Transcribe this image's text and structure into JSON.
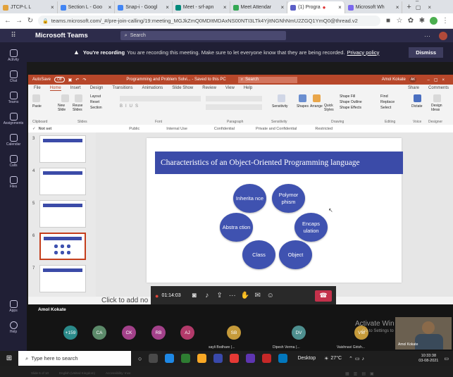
{
  "browser": {
    "tabs": [
      {
        "label": "JTCP-L L",
        "color": "#e2a23b"
      },
      {
        "label": "Section L - Goo",
        "color": "#4285f4"
      },
      {
        "label": "Snap-i - Googl",
        "color": "#4285f4"
      },
      {
        "label": "Meet - srf-apn",
        "color": "#00897b"
      },
      {
        "label": "Meet Attendar",
        "color": "#34a853"
      },
      {
        "label": "(1) Progra",
        "color": "#5b5fc7"
      },
      {
        "label": "Microsoft Wh",
        "color": "#7b68ee"
      }
    ],
    "url": "teams.microsoft.com/_#/pre-join-calling/19:meeting_MGJkZmQ0MDItMDAxNS00NTI3LTk4YjItNGNhNmU2ZGQ1YmQ0@thread.v2"
  },
  "teams": {
    "app_name": "Microsoft Teams",
    "search_placeholder": "Search",
    "rail": [
      "Activity",
      "Chat",
      "Teams",
      "Assignments",
      "Calendar",
      "Calls",
      "Files",
      "Apps",
      "Help"
    ],
    "recording_bold": "You're recording",
    "recording_msg": "You are recording this meeting. Make sure to let everyone know that they are being recorded.",
    "privacy_link": "Privacy policy",
    "dismiss": "Dismiss"
  },
  "ppt": {
    "autosave": "AutoSave",
    "autosave_state": "Off",
    "doc_title": "Programming and Problem Solvi... - Saved to this PC",
    "search": "Search",
    "user": "Amol Kokate",
    "user_initials": "AK",
    "tabs": [
      "File",
      "Home",
      "Insert",
      "Design",
      "Transitions",
      "Animations",
      "Slide Show",
      "Review",
      "View",
      "Help"
    ],
    "share": "Share",
    "comments": "Comments",
    "groups": [
      "Clipboard",
      "Slides",
      "Font",
      "Paragraph",
      "Sensitivity",
      "Drawing",
      "Editing",
      "Voice",
      "Designer"
    ],
    "ribbon_buttons": {
      "paste": "Paste",
      "new_slide": "New Slide",
      "reuse_slides": "Reuse Slides",
      "layout": "Layout",
      "reset": "Reset",
      "section": "Section",
      "sensitivity": "Sensitivity",
      "shapes": "Shapes",
      "arrange": "Arrange",
      "quick_styles": "Quick Styles",
      "shape_fill": "Shape Fill",
      "shape_outline": "Shape Outline",
      "shape_effects": "Shape Effects",
      "find": "Find",
      "replace": "Replace",
      "select": "Select",
      "dictate": "Dictate",
      "design_ideas": "Design Ideas"
    },
    "not_set": "Not set",
    "sensitivity_labels": [
      "Public",
      "Internal Use",
      "Confidential",
      "Private and Confidential",
      "Restricted"
    ],
    "thumb_numbers": [
      "3",
      "4",
      "5",
      "6",
      "7"
    ],
    "notes_placeholder": "Click to add no",
    "status_text": "Slide 6 of 10",
    "language": "English (United Kingdom)",
    "accessibility": "Accessibility: Inve"
  },
  "slide": {
    "title": "Characteristics of an Object-Oriented Programming language",
    "bubbles": [
      "Inherita nce",
      "Polymor phism",
      "Abstra ction",
      "Encaps ulation",
      "Class",
      "Object"
    ]
  },
  "meeting": {
    "timer": "01:14:03",
    "presenter": "Amol Kokate",
    "participants": [
      {
        "initials": "+159",
        "color": "#2b8a8a"
      },
      {
        "initials": "CA",
        "color": "#5c8a6a"
      },
      {
        "initials": "CK",
        "color": "#a3418a"
      },
      {
        "initials": "RB",
        "color": "#a3418a"
      },
      {
        "initials": "AJ",
        "color": "#b23a6a"
      },
      {
        "initials": "SB",
        "color": "#c59a3a"
      },
      {
        "initials": "DV",
        "color": "#4e8f8f"
      },
      {
        "initials": "VM",
        "color": "#c59a3a"
      }
    ],
    "names": [
      "sayli Bodhare (...",
      "Dipesh Verma (...",
      "Vaishnavi Girish...",
      "Amol Kokate"
    ],
    "activate_title": "Activate Win",
    "activate_sub": "Go to Settings to"
  },
  "taskbar": {
    "search_placeholder": "Type here to search",
    "desktop": "Desktop",
    "weather": "27°C",
    "time": "10:33:38",
    "date": "03-08-2021"
  }
}
